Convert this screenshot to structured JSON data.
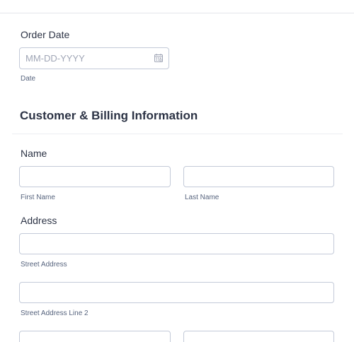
{
  "order_date": {
    "label": "Order Date",
    "placeholder": "MM-DD-YYYY",
    "sublabel": "Date",
    "icon": "calendar-icon"
  },
  "section": {
    "title": "Customer & Billing Information"
  },
  "name": {
    "label": "Name",
    "first_sublabel": "First Name",
    "last_sublabel": "Last Name"
  },
  "address": {
    "label": "Address",
    "street_sublabel": "Street Address",
    "street2_sublabel": "Street Address Line 2"
  },
  "colors": {
    "border": "#c3cad8",
    "text": "#2c3345",
    "sublabel": "#57647e"
  }
}
